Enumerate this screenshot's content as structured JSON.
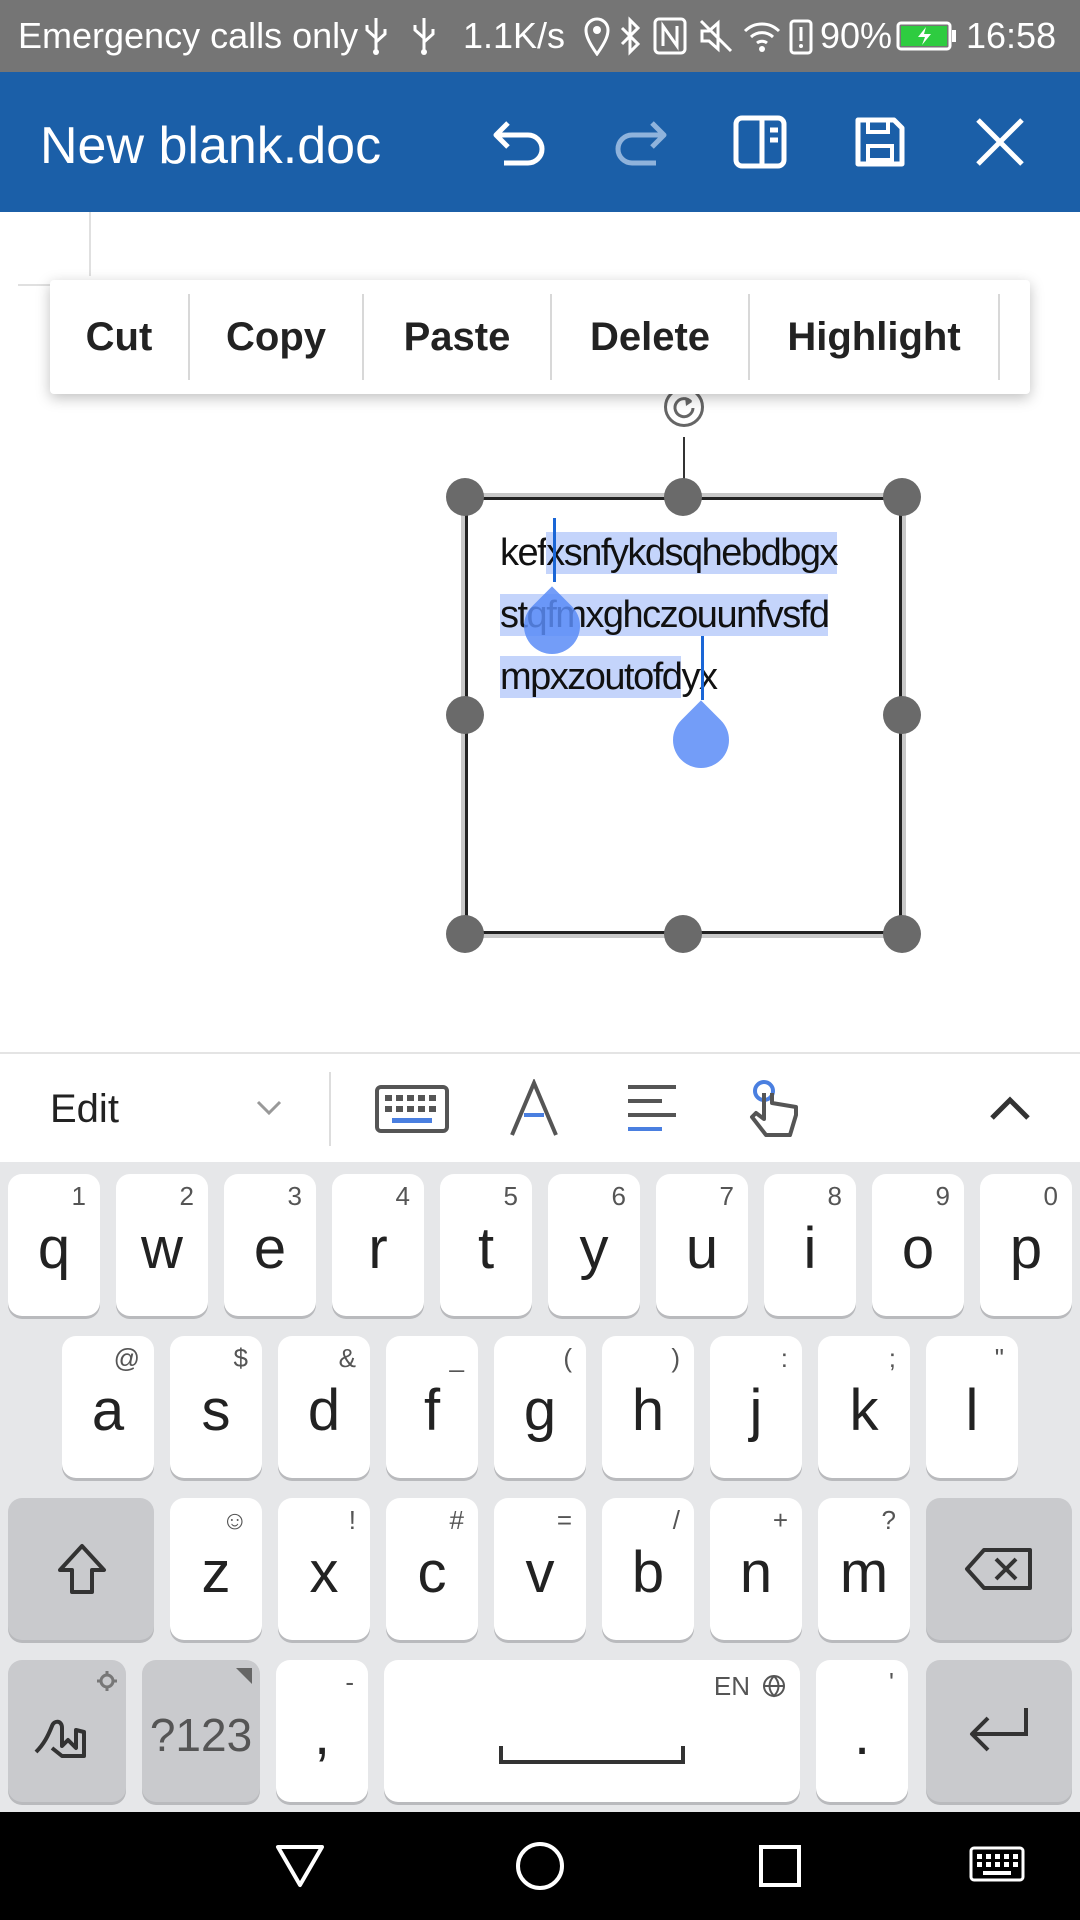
{
  "status_bar": {
    "carrier": "Emergency calls only",
    "speed": "1.1K/s",
    "battery": "90%",
    "time": "16:58"
  },
  "app_bar": {
    "title": "New blank.doc"
  },
  "context_menu": {
    "items": [
      "Cut",
      "Copy",
      "Paste",
      "Delete",
      "Highlight"
    ]
  },
  "text_box": {
    "lines": [
      {
        "before": "kef",
        "selected": "xsnfykdsqhebdbgx",
        "after": ""
      },
      {
        "before": "",
        "selected": "stqfmxghczouunfvsfd",
        "after": ""
      },
      {
        "before": "",
        "selected": "mpxzoutofd",
        "after": "yx"
      }
    ]
  },
  "kb_toolbar": {
    "mode_label": "Edit"
  },
  "keyboard": {
    "row1": [
      {
        "main": "q",
        "hint": "1"
      },
      {
        "main": "w",
        "hint": "2"
      },
      {
        "main": "e",
        "hint": "3"
      },
      {
        "main": "r",
        "hint": "4"
      },
      {
        "main": "t",
        "hint": "5"
      },
      {
        "main": "y",
        "hint": "6"
      },
      {
        "main": "u",
        "hint": "7"
      },
      {
        "main": "i",
        "hint": "8"
      },
      {
        "main": "o",
        "hint": "9"
      },
      {
        "main": "p",
        "hint": "0"
      }
    ],
    "row2": [
      {
        "main": "a",
        "hint": "@"
      },
      {
        "main": "s",
        "hint": "$"
      },
      {
        "main": "d",
        "hint": "&"
      },
      {
        "main": "f",
        "hint": "_"
      },
      {
        "main": "g",
        "hint": "("
      },
      {
        "main": "h",
        "hint": ")"
      },
      {
        "main": "j",
        "hint": ":"
      },
      {
        "main": "k",
        "hint": ";"
      },
      {
        "main": "l",
        "hint": "\""
      }
    ],
    "row3": [
      {
        "main": "z",
        "hint": "☺"
      },
      {
        "main": "x",
        "hint": "!"
      },
      {
        "main": "c",
        "hint": "#"
      },
      {
        "main": "v",
        "hint": "="
      },
      {
        "main": "b",
        "hint": "/"
      },
      {
        "main": "n",
        "hint": "+"
      },
      {
        "main": "m",
        "hint": "?"
      }
    ],
    "symbols_label": "?123",
    "comma": {
      "main": ",",
      "hint": "-"
    },
    "space_hint": "EN",
    "period": {
      "main": ".",
      "hint": "'"
    }
  }
}
